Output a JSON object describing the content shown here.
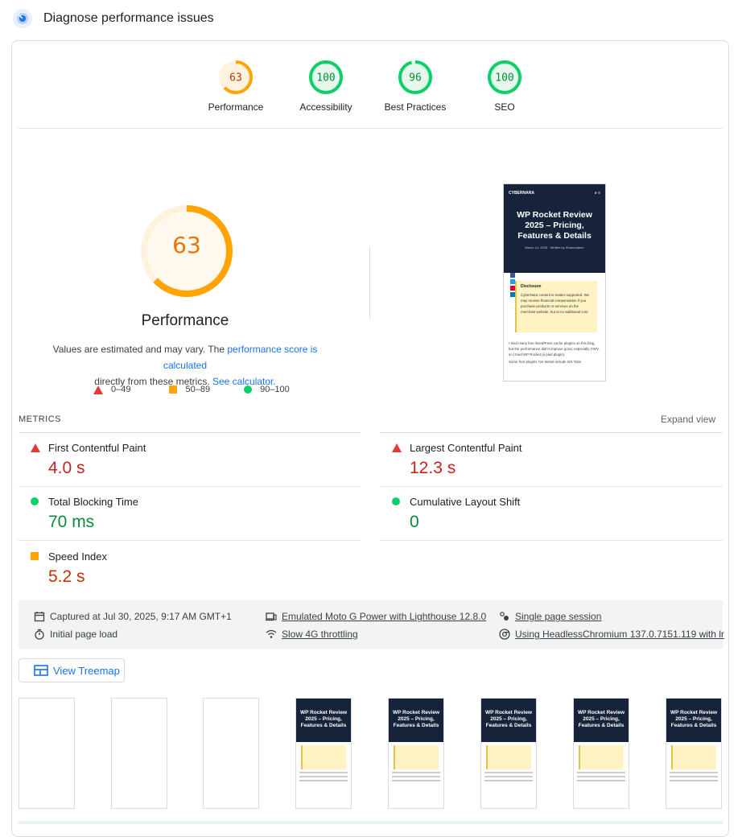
{
  "header": {
    "title": "Diagnose performance issues",
    "icon": "lighthouse-icon"
  },
  "categories": [
    {
      "label": "Performance",
      "score": "63",
      "color": "#ffa400",
      "fraction": 0.63
    },
    {
      "label": "Accessibility",
      "score": "100",
      "color": "#0cce6b",
      "fraction": 1.0
    },
    {
      "label": "Best Practices",
      "score": "96",
      "color": "#0cce6b",
      "fraction": 0.96
    },
    {
      "label": "SEO",
      "score": "100",
      "color": "#0cce6b",
      "fraction": 1.0
    }
  ],
  "performance": {
    "score": "63",
    "fraction": 0.63,
    "title": "Performance",
    "disclaimer_prefix": "Values are estimated and may vary. The",
    "score_link": "performance score is calculated",
    "disclaimer_middle": "directly from these metrics.",
    "calc_link": "See calculator."
  },
  "legend": {
    "poor": "0–49",
    "average": "50–89",
    "good": "90–100"
  },
  "screenshot": {
    "brand": "CYBERNARA",
    "title": "WP Rocket Review 2025 – Pricing, Features & Details",
    "byline": "March 14, 2025 · Written by Sharmudeen",
    "disclosure_title": "Disclosure",
    "disclosure_text": "CyberNara content is reader-supported. We may receive financial compensation if you purchase products or services on the merchant website, but at no additional cost.",
    "body1": "I tried many free WordPress cache plugins on this blog, but the performance didn't improve good, especially CWV, so I tried WP Rocket (a paid plugin).",
    "body2": "Some free plugins I've tested include W3 Total"
  },
  "metrics": {
    "label": "METRICS",
    "expand": "Expand view",
    "fcp": {
      "name": "First Contentful Paint",
      "value": "4.0 s"
    },
    "lcp": {
      "name": "Largest Contentful Paint",
      "value": "12.3 s"
    },
    "tbt": {
      "name": "Total Blocking Time",
      "value": "70 ms"
    },
    "cls": {
      "name": "Cumulative Layout Shift",
      "value": "0"
    },
    "si": {
      "name": "Speed Index",
      "value": "5.2 s"
    }
  },
  "info": {
    "captured": "Captured at Jul 30, 2025, 9:17 AM GMT+1",
    "load": "Initial page load",
    "device": "Emulated Moto G Power with Lighthouse 12.8.0",
    "throttle": "Slow 4G throttling",
    "session": "Single page session",
    "browser": "Using HeadlessChromium 137.0.7151.119 with lr"
  },
  "treemap": {
    "label": "View Treemap"
  },
  "filmstrip": {
    "title": "WP Rocket Review 2025 – Pricing, Features & Details"
  }
}
